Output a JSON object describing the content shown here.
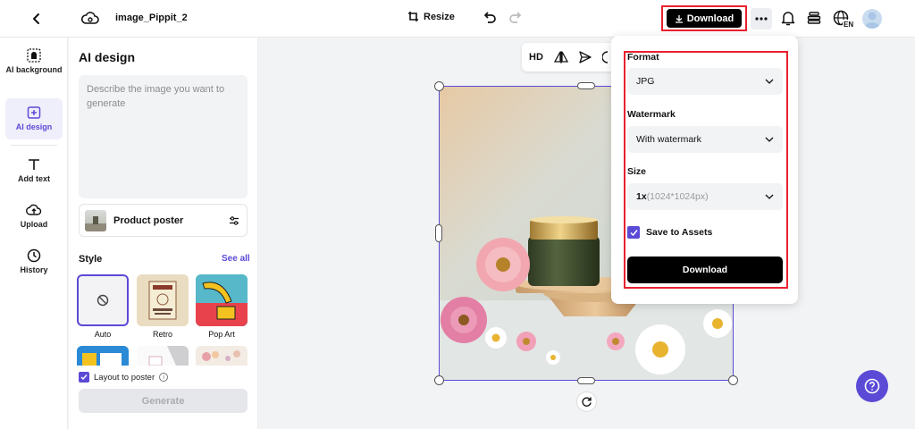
{
  "topbar": {
    "file_name": "image_Pippit_2(",
    "resize_label": "Resize",
    "download_label": "Download"
  },
  "rail": {
    "items": [
      {
        "label": "AI background",
        "icon": "ai-background-icon"
      },
      {
        "label": "AI design",
        "icon": "ai-design-icon",
        "active": true
      },
      {
        "label": "Add text",
        "icon": "text-icon"
      },
      {
        "label": "Upload",
        "icon": "upload-icon"
      },
      {
        "label": "History",
        "icon": "history-icon"
      }
    ]
  },
  "panel": {
    "title": "AI design",
    "prompt_placeholder": "Describe the image you want to generate",
    "preset_label": "Product poster",
    "style_title": "Style",
    "see_all": "See all",
    "styles": [
      {
        "label": "Auto"
      },
      {
        "label": "Retro"
      },
      {
        "label": "Pop Art"
      }
    ],
    "layout_label": "Layout to poster",
    "generate_label": "Generate"
  },
  "canvas": {
    "toolbar": {
      "hd_label": "HD"
    }
  },
  "download_panel": {
    "format_label": "Format",
    "format_value": "JPG",
    "watermark_label": "Watermark",
    "watermark_value": "With watermark",
    "size_label": "Size",
    "size_value": "1x",
    "size_detail": "(1024*1024px)",
    "save_label": "Save to Assets",
    "save_checked": true,
    "download_label": "Download"
  },
  "colors": {
    "accent": "#5b4ad6",
    "highlight": "#e8212f",
    "primary_button": "#000000"
  }
}
